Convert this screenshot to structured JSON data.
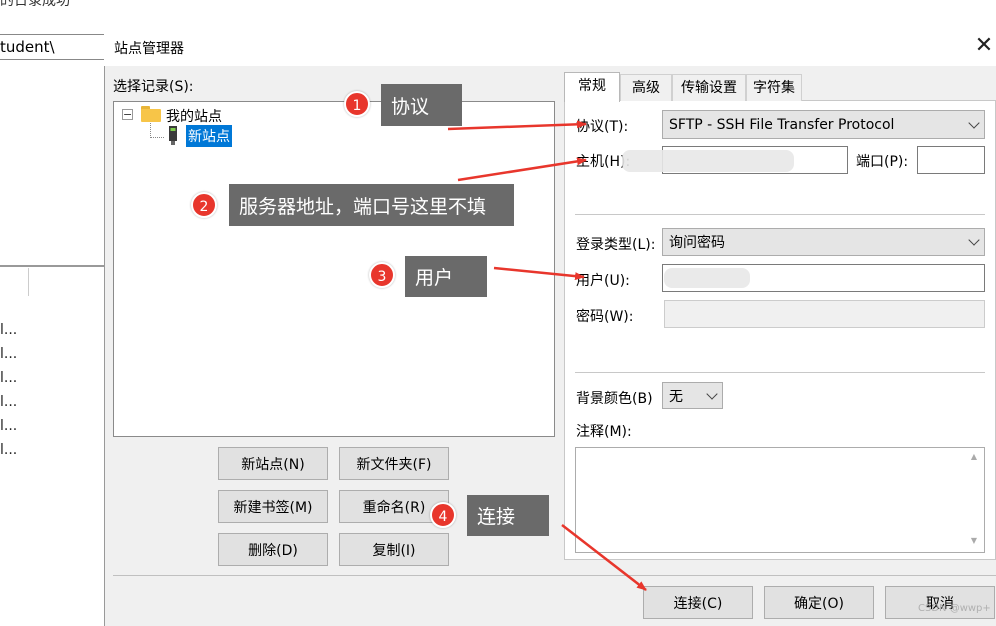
{
  "background": {
    "top_text": "的日录成功",
    "path_text": "tudent\\",
    "list_items": [
      "l...",
      "l...",
      "l...",
      "l...",
      "l...",
      "l..."
    ]
  },
  "dialog": {
    "title": "站点管理器",
    "close_glyph": "✕",
    "select_entry_label": "选择记录(S):",
    "tree": {
      "root_label": "我的站点",
      "root_toggle": "−",
      "child_label": "新站点"
    },
    "left_buttons": {
      "new_site": "新站点(N)",
      "new_folder": "新文件夹(F)",
      "new_bookmark": "新建书签(M)",
      "rename": "重命名(R)",
      "delete": "删除(D)",
      "copy": "复制(I)"
    },
    "tabs": [
      "常规",
      "高级",
      "传输设置",
      "字符集"
    ],
    "general": {
      "protocol_label": "协议(T):",
      "protocol_value": "SFTP - SSH File Transfer Protocol",
      "host_label": "主机(H):",
      "host_value": "",
      "port_label": "端口(P):",
      "port_value": "",
      "logon_type_label": "登录类型(L):",
      "logon_type_value": "询问密码",
      "user_label": "用户(U):",
      "user_value": "",
      "password_label": "密码(W):",
      "bg_color_label": "背景颜色(B)",
      "bg_color_value": "无",
      "comments_label": "注释(M):"
    },
    "bottom_buttons": {
      "connect": "连接(C)",
      "ok": "确定(O)",
      "cancel": "取消"
    }
  },
  "annotations": [
    {
      "number": "1",
      "text": "协议"
    },
    {
      "number": "2",
      "text": "服务器地址，端口号这里不填"
    },
    {
      "number": "3",
      "text": "用户"
    },
    {
      "number": "4",
      "text": "连接"
    }
  ],
  "watermark": "CSDN @wwp+",
  "colors": {
    "dialog_bg": "#f0f0f0",
    "selection": "#0078d7",
    "badge": "#e8362c",
    "callout": "#6a6a6a",
    "arrow": "#e8362c"
  }
}
